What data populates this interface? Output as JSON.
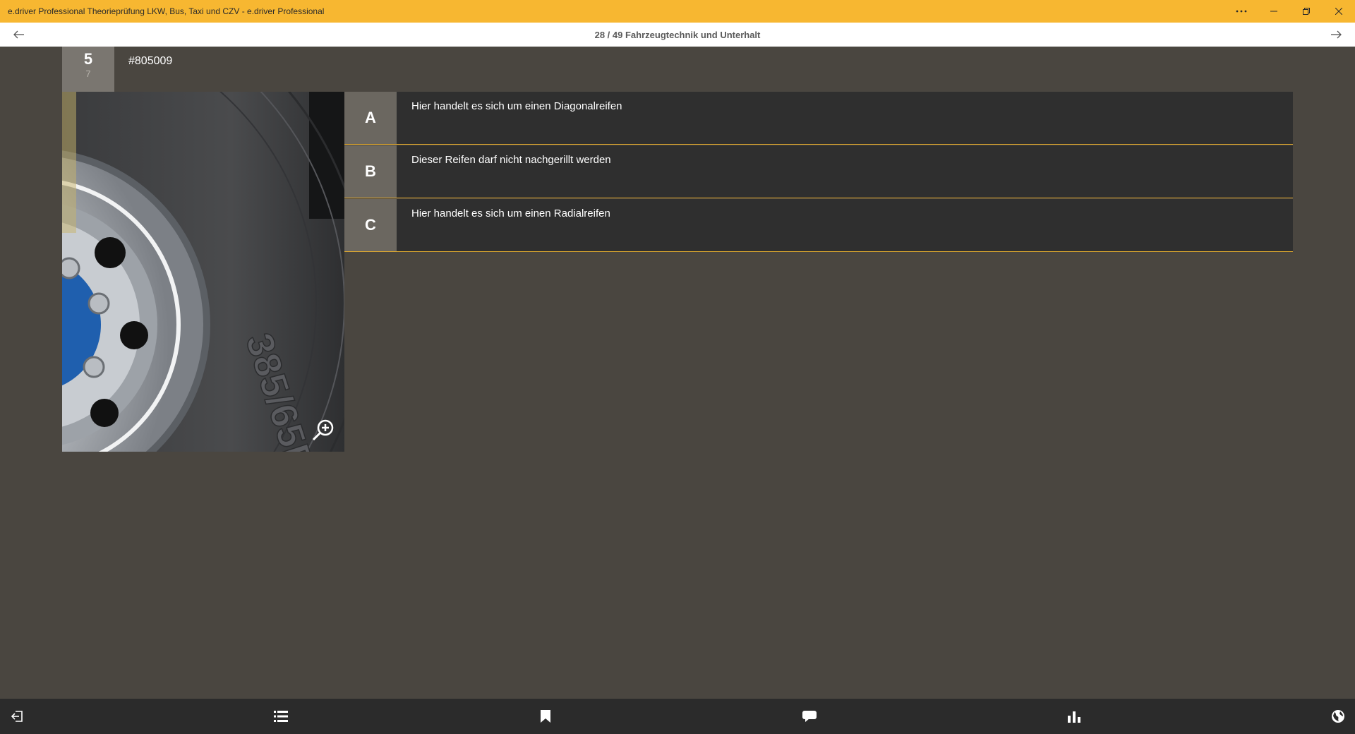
{
  "window": {
    "title": "e.driver Professional Theorieprüfung LKW, Bus, Taxi und CZV - e.driver Professional",
    "controls": [
      "more-icon",
      "minimize-icon",
      "restore-icon",
      "close-icon"
    ]
  },
  "nav": {
    "title": "28 / 49 Fahrzeugtechnik und Unterhalt",
    "back_icon": "arrow-left-icon",
    "forward_icon": "arrow-right-icon"
  },
  "question": {
    "points": "5",
    "sub": "7",
    "id": "#805009",
    "image": "truck-tire-photo",
    "answers": [
      {
        "letter": "A",
        "text": "Hier handelt es sich um einen Diagonalreifen"
      },
      {
        "letter": "B",
        "text": "Dieser Reifen darf nicht nachgerillt werden"
      },
      {
        "letter": "C",
        "text": "Hier handelt es sich um einen Radialreifen"
      }
    ]
  },
  "bottom_bar": [
    "exit-icon",
    "list-icon",
    "bookmark-icon",
    "comment-icon",
    "chart-icon",
    "globe-icon"
  ],
  "colors": {
    "accent": "#f7b731",
    "background": "#4a4640",
    "answer_bg": "#2f2f2f",
    "letter_bg": "#6b6760",
    "bottom_bar": "#2b2b2b"
  }
}
